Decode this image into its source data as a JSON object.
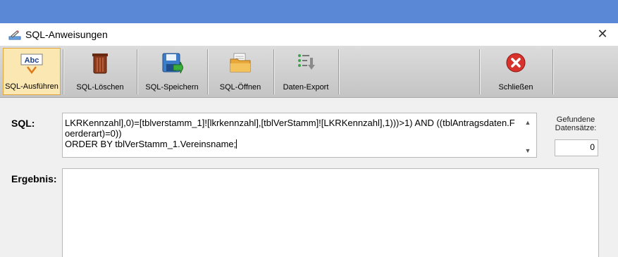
{
  "window": {
    "title": "SQL-Anweisungen",
    "close_glyph": "✕"
  },
  "toolbar": {
    "buttons": [
      {
        "label": "SQL-Ausführen",
        "icon": "abc-spellcheck-icon",
        "active": true
      },
      {
        "label": "SQL-Löschen",
        "icon": "trash-bin-icon"
      },
      {
        "label": "SQL-Speichern",
        "icon": "save-disk-icon"
      },
      {
        "label": "SQL-Öffnen",
        "icon": "open-folder-icon"
      },
      {
        "label": "Daten-Export",
        "icon": "export-list-icon"
      },
      {
        "label": "Schließen",
        "icon": "close-red-icon"
      }
    ]
  },
  "form": {
    "sql_label": "SQL:",
    "sql_text": "LKRKennzahl],0)=[tblverstamm_1]![lkrkennzahl],[tblVerStamm]![LKRKennzahl],1)))>1) AND ((tblAntragsdaten.Foerderart)=0))\nORDER BY tblVerStamm_1.Vereinsname;",
    "result_label": "Ergebnis:",
    "result_text": "",
    "found_label": "Gefundene Datensätze:",
    "found_value": "0"
  },
  "colors": {
    "top_band": "#5a87d6",
    "active_button_bg": "#fbe7b2",
    "active_button_border": "#e2a63a"
  }
}
